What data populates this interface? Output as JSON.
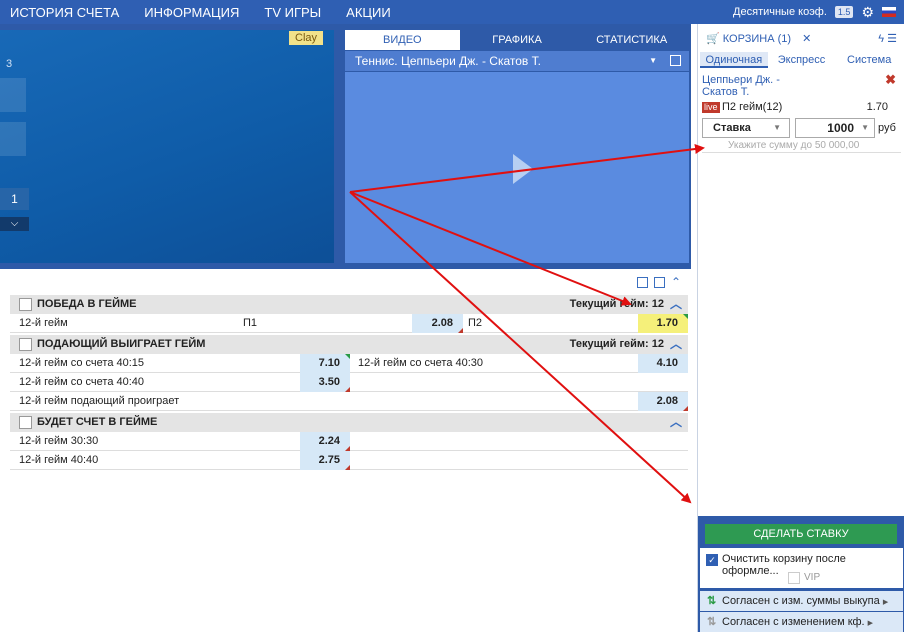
{
  "topnav": {
    "items": [
      "ИСТОРИЯ СЧЕТА",
      "ИНФОРМАЦИЯ",
      "TV ИГРЫ",
      "АКЦИИ"
    ],
    "decimal_label": "Десятичные коэф.",
    "decimal_badge": "1.5"
  },
  "court": {
    "surface": "Clay",
    "set_label": "3",
    "score": "1"
  },
  "video": {
    "tabs": [
      "ВИДЕО",
      "ГРАФИКА",
      "СТАТИСТИКА"
    ],
    "title": "Теннис. Цеппьери Дж. - Скатов Т."
  },
  "markets": [
    {
      "title": "ПОБЕДА В ГЕЙМЕ",
      "current": "Текущий гейм: 12",
      "rows": [
        {
          "label": "12-й гейм",
          "o1_label": "П1",
          "o1": "2.08",
          "o2_label": "П2",
          "o2": "1.70"
        }
      ]
    },
    {
      "title": "ПОДАЮЩИЙ ВЫИГРАЕТ ГЕЙМ",
      "current": "Текущий гейм: 12",
      "rows": [
        {
          "label": "12-й гейм со счета 40:15",
          "o1": "7.10",
          "label2": "12-й гейм со счета 40:30",
          "o2": "4.10"
        },
        {
          "label": "12-й гейм со счета 40:40",
          "o1": "3.50"
        },
        {
          "label": "12-й гейм подающий проиграет",
          "o2": "2.08"
        }
      ]
    },
    {
      "title": "БУДЕТ СЧЕТ В ГЕЙМЕ",
      "rows": [
        {
          "label": "12-й гейм 30:30",
          "o1": "2.24"
        },
        {
          "label": "12-й гейм 40:40",
          "o1": "2.75"
        }
      ]
    }
  ],
  "cart": {
    "title": "КОРЗИНА (1)",
    "tabs": [
      "Одиночная",
      "Экспресс",
      "Система"
    ],
    "event_line1": "Цеппьери Дж. -",
    "event_line2": "Скатов Т.",
    "live": "live",
    "bet_type": "П2 гейм(12)",
    "coef": "1.70",
    "stake_select": "Ставка",
    "stake_value": "1000",
    "currency": "руб",
    "hint": "Укажите сумму до 50 000,00",
    "make_bet": "СДЕЛАТЬ СТАВКУ",
    "clear_option": "Очистить корзину после оформле...",
    "vip": "VIP",
    "agree1": "Согласен с изм. суммы выкупа",
    "agree2": "Согласен с изменением кф."
  },
  "colors": {
    "brand": "#2f5fb3",
    "accent_green": "#2e9a52",
    "highlight": "#f5f07a",
    "arrow": "#e01010"
  }
}
